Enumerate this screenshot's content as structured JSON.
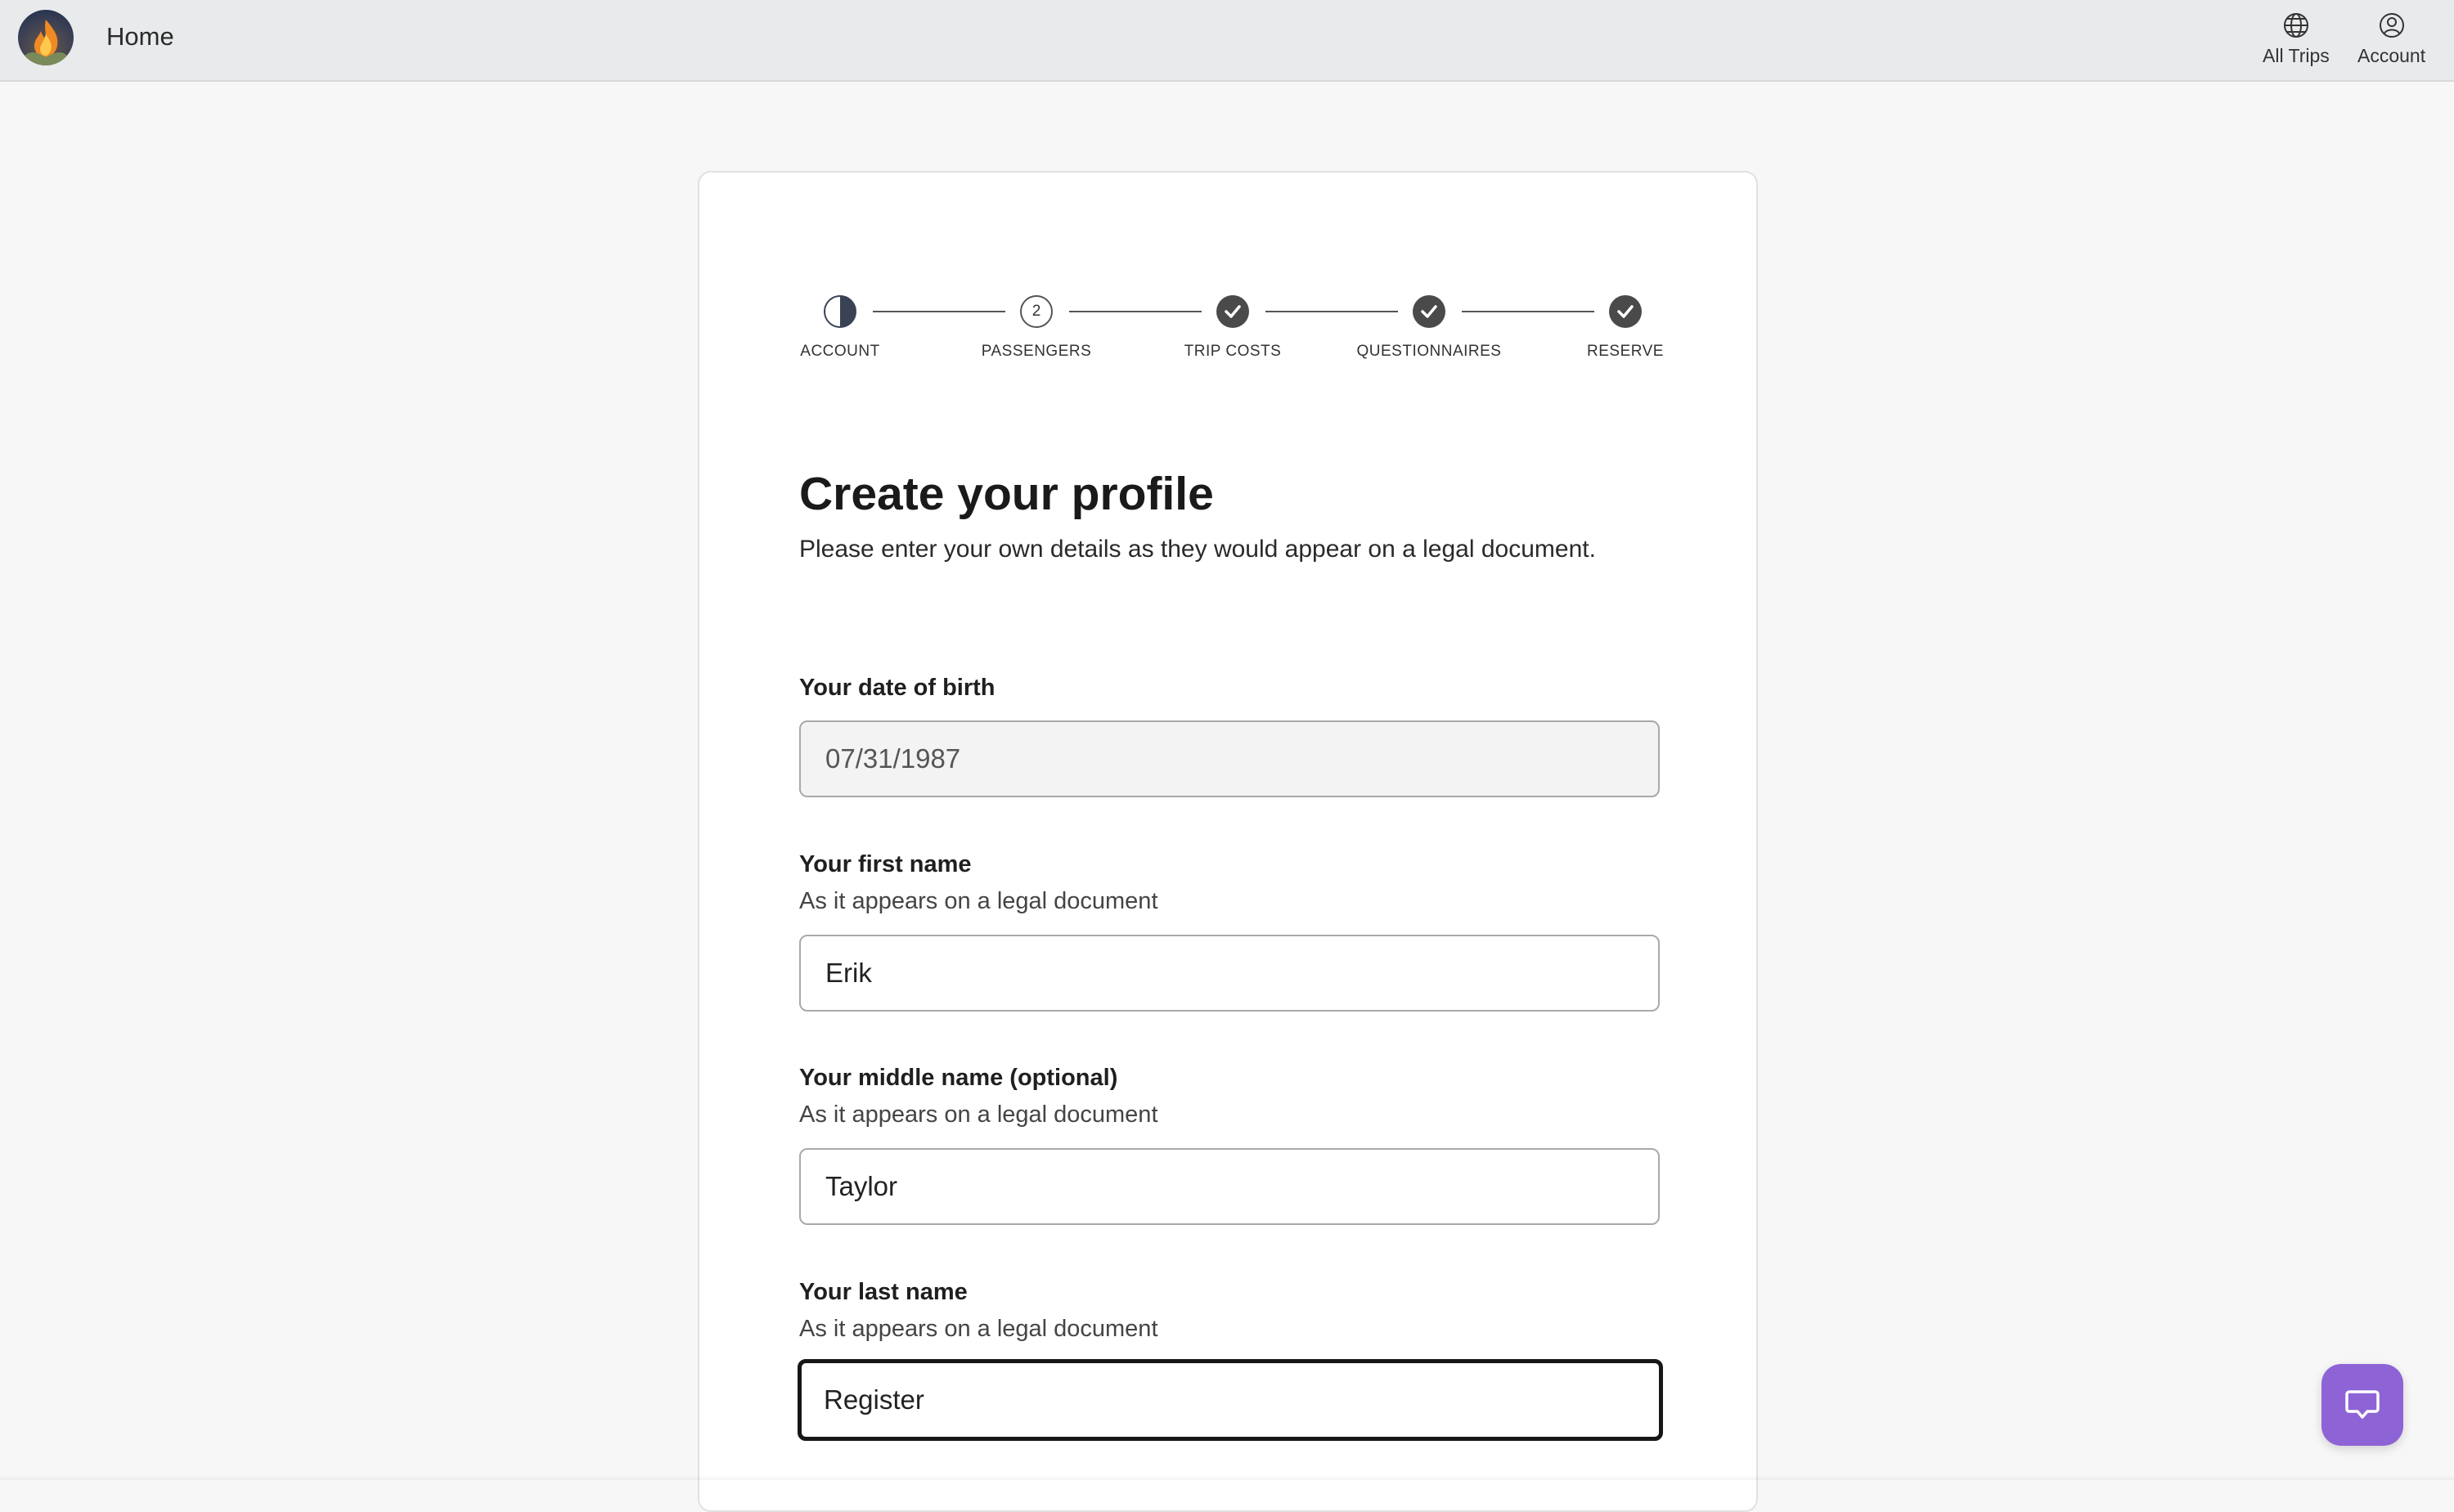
{
  "header": {
    "home_label": "Home",
    "nav": [
      {
        "label": "All Trips",
        "icon": "globe-icon"
      },
      {
        "label": "Account",
        "icon": "user-circle-icon"
      }
    ]
  },
  "stepper": {
    "steps": [
      {
        "label": "ACCOUNT",
        "state": "in-progress"
      },
      {
        "label": "PASSENGERS",
        "state": "numbered",
        "number": "2"
      },
      {
        "label": "TRIP COSTS",
        "state": "done"
      },
      {
        "label": "QUESTIONNAIRES",
        "state": "done"
      },
      {
        "label": "RESERVE",
        "state": "done"
      }
    ]
  },
  "page": {
    "title": "Create your profile",
    "subtitle": "Please enter your own details as they would appear on a legal document."
  },
  "form": {
    "dob": {
      "label": "Your date of birth",
      "value": "07/31/1987"
    },
    "first_name": {
      "label": "Your first name",
      "hint": "As it appears on a legal document",
      "value": "Erik"
    },
    "middle_name": {
      "label": "Your middle name (optional)",
      "hint": "As it appears on a legal document",
      "value": "Taylor"
    },
    "last_name": {
      "label": "Your last name",
      "hint": "As it appears on a legal document",
      "value": "Register"
    }
  },
  "colors": {
    "accent_chat": "#8e63d6",
    "step_done": "#4a4a4a",
    "step_in_progress": "#3a4256"
  },
  "chat": {
    "icon": "chat-bubble-icon"
  }
}
